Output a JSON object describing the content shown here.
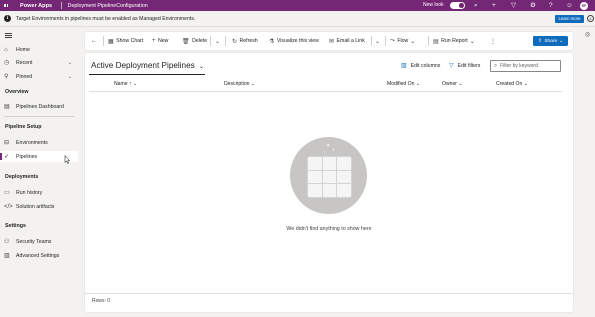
{
  "topbar": {
    "app_name": "Power Apps",
    "environment": "Deployment PipelineConfiguration",
    "new_look_label": "New look",
    "avatar_initials": "RP",
    "accent": "#742774"
  },
  "notice": {
    "icon": "info-icon",
    "text": "Target Environments in pipelines must be enabled as Managed Environments.",
    "learn_more": "Learn more",
    "close_icon": "close-icon"
  },
  "sidebar": {
    "top_items": [
      {
        "label": "Home",
        "icon": "home-icon"
      },
      {
        "label": "Recent",
        "icon": "clock-icon"
      },
      {
        "label": "Pinned",
        "icon": "pin-icon"
      }
    ],
    "sections": [
      {
        "title": "Overview",
        "items": [
          {
            "label": "Pipelines Dashboard",
            "icon": "dashboard-icon"
          }
        ]
      },
      {
        "title": "Pipeline Setup",
        "items": [
          {
            "label": "Environments",
            "icon": "environment-icon"
          },
          {
            "label": "Pipelines",
            "icon": "rocket-icon",
            "active": true
          }
        ]
      },
      {
        "title": "Deployments",
        "items": [
          {
            "label": "Run history",
            "icon": "history-icon"
          },
          {
            "label": "Solution artifacts",
            "icon": "code-icon"
          }
        ]
      },
      {
        "title": "Settings",
        "items": [
          {
            "label": "Security Teams",
            "icon": "team-icon"
          },
          {
            "label": "Advanced Settings",
            "icon": "settings-icon"
          }
        ]
      }
    ]
  },
  "commandbar": {
    "back": "←",
    "show_chart": "Show Chart",
    "new": "New",
    "delete": "Delete",
    "refresh": "Refresh",
    "visualize": "Visualize this view",
    "email_link": "Email a Link",
    "flow": "Flow",
    "run_report": "Run Report",
    "more": "⋮",
    "share": "Share"
  },
  "view": {
    "title": "Active Deployment Pipelines",
    "edit_columns": "Edit columns",
    "edit_filters": "Edit filters",
    "filter_placeholder": "Filter by keyword",
    "columns": [
      "Name ↑",
      "Description",
      "Modified On",
      "Owner",
      "Created On"
    ],
    "empty_message": "We didn't find anything to show here",
    "rows_label": "Rows: 0"
  }
}
